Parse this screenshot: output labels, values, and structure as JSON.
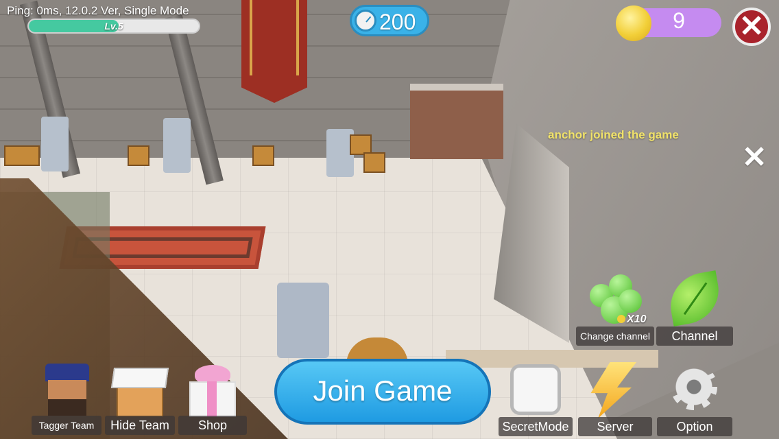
{
  "hud": {
    "status_text": "Ping: 0ms, 12.0.2 Ver, Single Mode",
    "level_label": "Lv.5",
    "level_progress": 0.53,
    "timer_value": "200",
    "coins": "9",
    "notification": "anchor joined the game"
  },
  "channel": {
    "change_cost": "X10",
    "change_label": "Change channel",
    "channel_label": "Channel"
  },
  "bottom_bar": {
    "tagger_team": "Tagger Team",
    "hide_team": "Hide Team",
    "shop": "Shop",
    "join_game": "Join Game",
    "secret_mode": "SecretMode",
    "server": "Server",
    "option": "Option"
  },
  "colors": {
    "join_button": "#2ea8ea",
    "timer_pill": "#3ab2e8",
    "coin_pill": "#c58bf0",
    "close_button": "#a9232c",
    "notification_text": "#f0e26a",
    "xp_fill": "#45c9a0"
  },
  "icons": {
    "timer": "stopwatch-icon",
    "coin": "coin-icon",
    "close": "close-icon",
    "gems": "green-gems-icon",
    "leaf": "leaf-icon",
    "tagger": "police-character-icon",
    "hide": "box-character-icon",
    "shop": "gift-box-icon",
    "server": "lightning-icon",
    "option": "gear-icon"
  }
}
